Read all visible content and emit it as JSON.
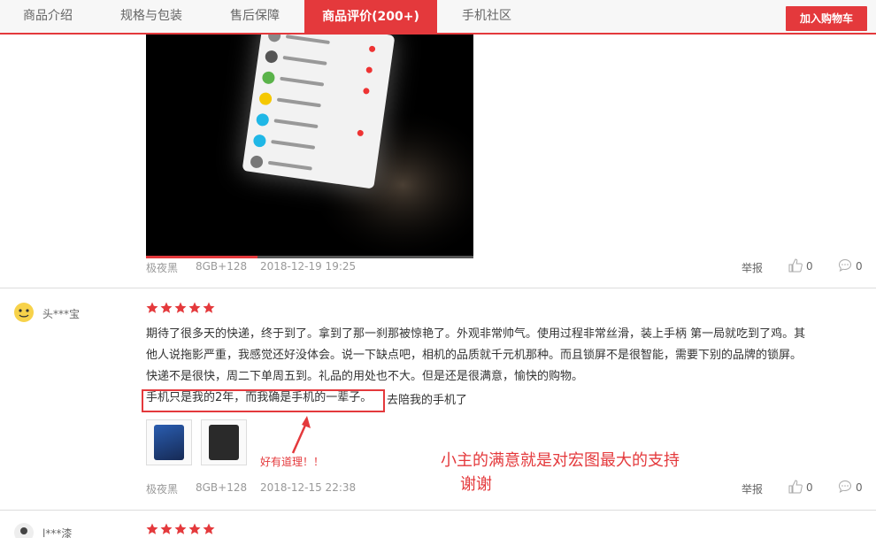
{
  "tabs": [
    {
      "label": "商品介绍",
      "active": false
    },
    {
      "label": "规格与包装",
      "active": false
    },
    {
      "label": "售后保障",
      "active": false
    },
    {
      "label": "商品评价(200+)",
      "active": true
    },
    {
      "label": "手机社区",
      "active": false
    }
  ],
  "cart_button": "加入购物车",
  "colors": {
    "accent": "#e4393c"
  },
  "video_review": {
    "color": "极夜黑",
    "spec": "8GB+128",
    "date": "2018-12-19 19:25",
    "report": "举报",
    "likes": "0",
    "comments": "0",
    "progress": 0.34
  },
  "review": {
    "username": "头***宝",
    "rating": 5,
    "lines": [
      "期待了很多天的快递，终于到了。拿到了那一刹那被惊艳了。外观非常帅气。使用过程非常丝滑，装上手柄 第一局就吃到了鸡。其",
      "他人说拖影严重，我感觉还好没体会。说一下缺点吧，相机的品质就千元机那种。而且锁屏不是很智能，需要下别的品牌的锁屏。",
      "快递不是很快，周二下单周五到。礼品的用处也不大。但是还是很满意，愉快的购物。"
    ],
    "highlight": "手机只是我的2年，而我确是手机的一辈子。",
    "after_highlight": "去陪我的手机了",
    "annotation_small": "好有道理！！",
    "annotation_big_1": "小主的满意就是对宏图最大的支持",
    "annotation_big_2": "谢谢",
    "color": "极夜黑",
    "spec": "8GB+128",
    "date": "2018-12-15 22:38",
    "report": "举报",
    "likes": "0",
    "comments": "0"
  },
  "next_review": {
    "username": "l***漆",
    "rating": 5
  }
}
